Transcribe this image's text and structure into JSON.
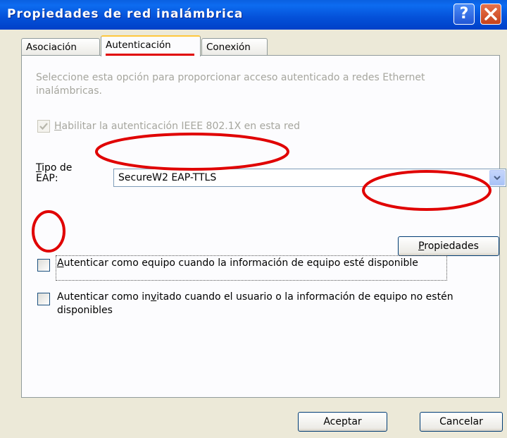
{
  "window": {
    "title": "Propiedades de red inalámbrica",
    "help_glyph": "?",
    "close_glyph": "✕"
  },
  "tabs": [
    {
      "label": "Asociación",
      "selected": false
    },
    {
      "label": "Autenticación",
      "selected": true
    },
    {
      "label": "Conexión",
      "selected": false
    }
  ],
  "auth": {
    "description": "Seleccione esta opción para proporcionar acceso autenticado a redes Ethernet inalámbricas.",
    "enable_8021x": {
      "label_pre": "",
      "label_acc": "H",
      "label_post": "abilitar la autenticación IEEE 802.1X en esta red",
      "checked": true,
      "enabled": false
    },
    "eap_type_label_acc": "T",
    "eap_type_label_rest_line1": "ipo de",
    "eap_type_label_line2": "EAP:",
    "eap_type_value": "SecureW2 EAP-TTLS",
    "properties_button": {
      "acc": "P",
      "rest": "ropiedades"
    },
    "computer_auth": {
      "label_pre": "",
      "label_acc": "A",
      "label_post": "utenticar como equipo cuando la información de equipo esté disponible",
      "checked": false
    },
    "guest_auth": {
      "label_pre": "Autenticar como in",
      "label_acc": "v",
      "label_post": "itado cuando el usuario o la información de equipo no estén disponibles",
      "checked": false
    }
  },
  "footer": {
    "ok_label": "Aceptar",
    "cancel_label": "Cancelar"
  },
  "annotations": {
    "color": "#e00000"
  }
}
